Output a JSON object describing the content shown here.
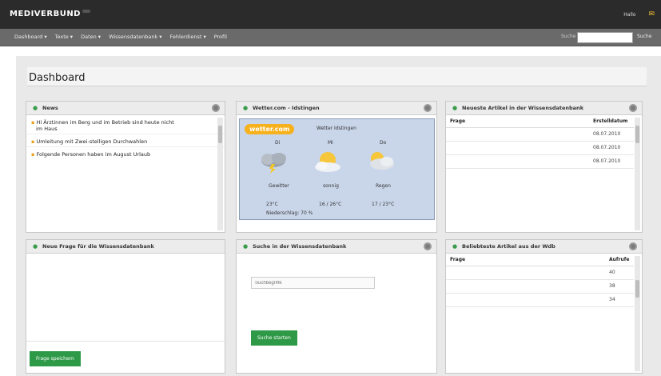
{
  "app": {
    "brand": "MEDIVERBUND",
    "brand_sub": "",
    "top_right": [
      "Hallo",
      ""
    ]
  },
  "nav": {
    "items": [
      "Dashboard ▾",
      "Texte ▾",
      "Daten ▾",
      "Wissensdatenbank ▾",
      "Fehlerdienst ▾",
      "Profil"
    ],
    "search_label": "Suche",
    "search_placeholder": "",
    "search_button": "Suche"
  },
  "page": {
    "title": "Dashboard"
  },
  "news": {
    "title": "News",
    "items": [
      {
        "meta": "",
        "title_lines": [
          "Hi Ärztinnen im Berg und im Betrieb sind heute nicht",
          "im Haus"
        ]
      },
      {
        "meta": "",
        "title_lines": [
          "Umleitung mit Zwei-stelligen Durchwahlen"
        ]
      },
      {
        "meta": "",
        "title_lines": [
          "Folgende Personen haben im August Urlaub"
        ]
      }
    ]
  },
  "weather": {
    "title": "Wetter.com - Idstingen",
    "logo": "wetter.com",
    "location": "Wetter Idstingen",
    "days": [
      {
        "day": "Di",
        "condition": "Gewitter",
        "temp": "23°C",
        "icon": "storm-icon"
      },
      {
        "day": "Mi",
        "condition": "sonnig",
        "temp": "16 / 26°C",
        "icon": "sun-icon"
      },
      {
        "day": "Do",
        "condition": "Regen",
        "temp": "17 / 23°C",
        "icon": "rain-cloud-icon"
      }
    ],
    "rain": "Niederschlag: 70 %"
  },
  "articles": {
    "title": "Neueste Artikel in der Wissensdatenbank",
    "col_question": "Frage",
    "col_created": "Erstelldatum",
    "rows": [
      {
        "q": "",
        "date": "08.07.2010"
      },
      {
        "q": "",
        "date": "08.07.2010"
      },
      {
        "q": "",
        "date": "08.07.2010"
      }
    ]
  },
  "new_question": {
    "title": "Neue Frage für die Wissensdatenbank",
    "body": "",
    "button": "Frage speichern"
  },
  "kb_search": {
    "title": "Suche in der Wissensdatenbank",
    "placeholder": "Suchbegriffe",
    "help": "",
    "button": "Suche starten"
  },
  "popular": {
    "title": "Beliebteste Artikel aus der Wdb",
    "col_question": "Frage",
    "col_views": "Aufrufe",
    "rows": [
      {
        "q": "",
        "views": "40"
      },
      {
        "q": "",
        "views": "38"
      },
      {
        "q": "",
        "views": "34"
      }
    ]
  },
  "colors": {
    "topbar": "#2b2b2b",
    "navbar": "#6a6a6a",
    "accent_green": "#2e9947",
    "weather_bg": "#c9d6ea",
    "logo_orange": "#f6b11d"
  }
}
